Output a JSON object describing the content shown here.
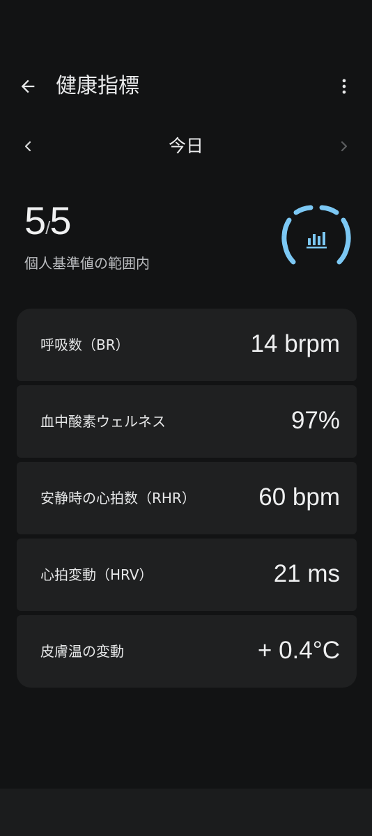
{
  "header": {
    "title": "健康指標",
    "back_icon": "arrow-left-icon",
    "menu_icon": "more-vert-icon"
  },
  "date_nav": {
    "label": "今日",
    "prev_icon": "chevron-left-icon",
    "next_icon": "chevron-right-icon"
  },
  "summary": {
    "score": "5",
    "total": "5",
    "caption": "個人基準値の範囲内",
    "gauge_icon": "bar-chart-icon",
    "accent_color": "#7cc8f4"
  },
  "metrics": [
    {
      "label": "呼吸数（BR）",
      "value": "14 brpm"
    },
    {
      "label": "血中酸素ウェルネス",
      "value": "97%"
    },
    {
      "label": "安静時の心拍数（RHR）",
      "value": "60 bpm"
    },
    {
      "label": "心拍変動（HRV）",
      "value": "21 ms"
    },
    {
      "label": "皮膚温の変動",
      "value": "+ 0.4°C"
    }
  ],
  "colors": {
    "background": "#121314",
    "card": "#1f2021",
    "text": "#e7e8e9",
    "accent": "#7cc8f4"
  }
}
